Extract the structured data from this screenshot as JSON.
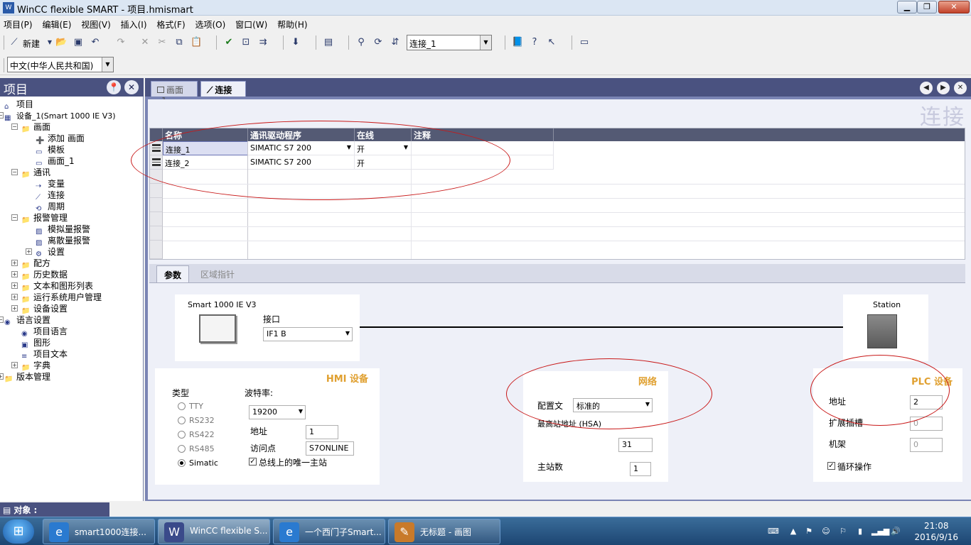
{
  "window": {
    "title": "WinCC flexible SMART - 项目.hmismart",
    "icon": "wincc-app-icon"
  },
  "menu": [
    "项目(P)",
    "编辑(E)",
    "视图(V)",
    "插入(I)",
    "格式(F)",
    "选项(O)",
    "窗口(W)",
    "帮助(H)"
  ],
  "toolbar": {
    "new_label": "新建",
    "connection_combo": "连接_1",
    "language_combo": "中文(中华人民共和国)"
  },
  "project": {
    "header": "项目",
    "tree": [
      {
        "label": "项目",
        "level": 0
      },
      {
        "label": "设备_1(Smart 1000 IE V3)",
        "level": 0
      },
      {
        "label": "画面",
        "level": 1
      },
      {
        "label": "添加 画面",
        "level": 2
      },
      {
        "label": "模板",
        "level": 2
      },
      {
        "label": "画面_1",
        "level": 2
      },
      {
        "label": "通讯",
        "level": 1
      },
      {
        "label": "变量",
        "level": 2
      },
      {
        "label": "连接",
        "level": 2
      },
      {
        "label": "周期",
        "level": 2
      },
      {
        "label": "报警管理",
        "level": 1
      },
      {
        "label": "模拟量报警",
        "level": 2
      },
      {
        "label": "离散量报警",
        "level": 2
      },
      {
        "label": "设置",
        "level": 2
      },
      {
        "label": "配方",
        "level": 1
      },
      {
        "label": "历史数据",
        "level": 1
      },
      {
        "label": "文本和图形列表",
        "level": 1
      },
      {
        "label": "运行系统用户管理",
        "level": 1
      },
      {
        "label": "设备设置",
        "level": 1
      },
      {
        "label": "语言设置",
        "level": 0
      },
      {
        "label": "项目语言",
        "level": 1
      },
      {
        "label": "图形",
        "level": 1
      },
      {
        "label": "项目文本",
        "level": 1
      },
      {
        "label": "字典",
        "level": 1
      },
      {
        "label": "版本管理",
        "level": 0
      }
    ]
  },
  "tabs": [
    "画面_1",
    "连接"
  ],
  "editor_title": "连接",
  "grid": {
    "columns": [
      "名称",
      "通讯驱动程序",
      "在线",
      "注释"
    ],
    "rows": [
      {
        "name": "连接_1",
        "driver": "SIMATIC S7 200",
        "online": "开",
        "comment": ""
      },
      {
        "name": "连接_2",
        "driver": "SIMATIC S7 200",
        "online": "开",
        "comment": ""
      }
    ]
  },
  "prop_tabs": [
    "参数",
    "区域指针"
  ],
  "hmi_device": {
    "device_name": "Smart 1000 IE V3",
    "interface_label": "接口",
    "interface_value": "IF1 B",
    "section_title": "HMI 设备",
    "type_label": "类型",
    "types": [
      "TTY",
      "RS232",
      "RS422",
      "RS485",
      "Simatic"
    ],
    "baud_label": "波特率:",
    "baud_value": "19200",
    "address_label": "地址",
    "address_value": "1",
    "access_point_label": "访问点",
    "access_point_value": "S7ONLINE",
    "only_master_label": "总线上的唯一主站"
  },
  "network": {
    "section_title": "网络",
    "profile_label": "配置文",
    "profile_value": "标准的",
    "hsa_label": "最高站地址 (HSA)",
    "hsa_value": "31",
    "masters_label": "主站数",
    "masters_value": "1"
  },
  "plc_device": {
    "station_label": "Station",
    "section_title": "PLC 设备",
    "address_label": "地址",
    "address_value": "2",
    "slot_label": "扩展插槽",
    "slot_value": "0",
    "rack_label": "机架",
    "rack_value": "0",
    "cyclic_label": "循环操作"
  },
  "object_bar": {
    "label": "对象 :"
  },
  "taskbar": {
    "tasks": [
      {
        "label": "smart1000连接...",
        "icon": "ie-icon"
      },
      {
        "label": "WinCC flexible S...",
        "icon": "wincc-icon"
      },
      {
        "label": "一个西门子Smart...",
        "icon": "ie-icon"
      },
      {
        "label": "无标题 - 画图",
        "icon": "paint-icon"
      }
    ],
    "time": "21:08",
    "date": "2016/9/16"
  },
  "colors": {
    "panel_header": "#4a5280",
    "workspace_bg": "#7a84b4",
    "section_title": "#e0a030",
    "annotation_oval": "#c81818"
  }
}
